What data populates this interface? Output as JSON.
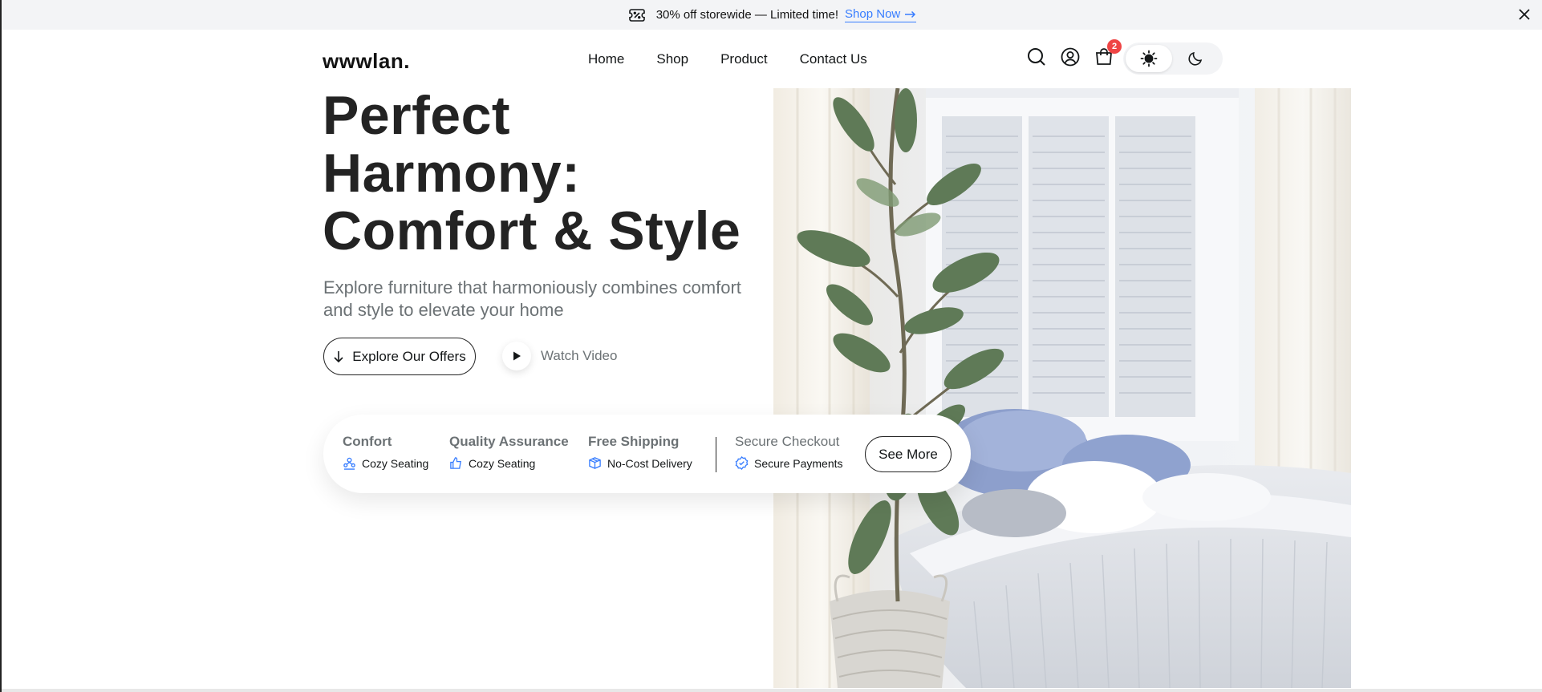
{
  "announcement": {
    "text": "30% off storewide — Limited time!",
    "link_label": "Shop Now"
  },
  "header": {
    "logo": "wwwlan.",
    "nav": [
      "Home",
      "Shop",
      "Product",
      "Contact Us"
    ],
    "cart_count": "2",
    "icons": [
      "search-icon",
      "user-icon",
      "cart-icon",
      "sun-icon",
      "moon-icon"
    ],
    "theme_selected": "light"
  },
  "hero": {
    "title_lines": [
      "Perfect",
      "Harmony:",
      "Comfort & Style"
    ],
    "subtitle": "Explore furniture that harmoniously combines comfort and style to elevate your home",
    "explore_label": "Explore Our Offers",
    "watch_label": "Watch Video"
  },
  "features": [
    {
      "title": "Confort",
      "subtitle": "Cozy Seating",
      "icon": "people-icon"
    },
    {
      "title": "Quality Assurance",
      "subtitle": "Cozy Seating",
      "icon": "thumbs-up-icon"
    },
    {
      "title": "Free Shipping",
      "subtitle": "No-Cost Delivery",
      "icon": "box-icon"
    },
    {
      "title": "Secure Checkout",
      "subtitle": "Secure Payments",
      "icon": "verified-icon"
    }
  ],
  "see_more_label": "See More",
  "colors": {
    "accent_blue": "#377dff",
    "badge_red": "#ef4444",
    "text_dark": "#232323",
    "text_muted": "#6c7275"
  }
}
